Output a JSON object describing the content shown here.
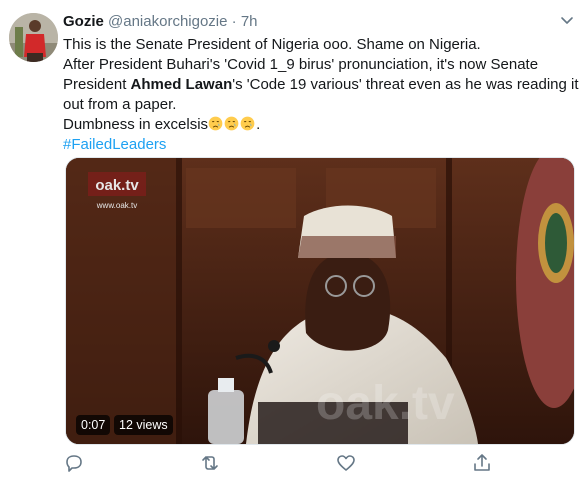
{
  "tweet": {
    "author_name": "Gozie",
    "handle": "@aniakorchigozie",
    "separator": "·",
    "time": "7h",
    "text": {
      "line1": "This is the Senate President of Nigeria ooo. Shame on Nigeria.",
      "line2": "After President Buhari's 'Covid 1_9 birus' pronunciation, it's now Senate",
      "line3_pre": "President ",
      "line3_bold": "Ahmed Lawan",
      "line3_post": "'s 'Code 19 various' threat even as he was reading it",
      "line4": "out from a paper.",
      "line5_pre": "Dumbness in excelsis",
      "line5_post": ".",
      "hashtag": "#FailedLeaders"
    },
    "emojis": [
      "crying-face",
      "crying-face",
      "crying-face"
    ],
    "media": {
      "type": "video",
      "duration": "0:07",
      "views": "12 views",
      "logo_text": "oak.tv",
      "logo_url": "www.oak.tv",
      "watermark": "oak.tv"
    },
    "actions": [
      "reply-icon",
      "retweet-icon",
      "like-icon",
      "share-icon"
    ]
  },
  "colors": {
    "accent": "#1da1f2",
    "text": "#14171a",
    "secondary": "#657786"
  }
}
